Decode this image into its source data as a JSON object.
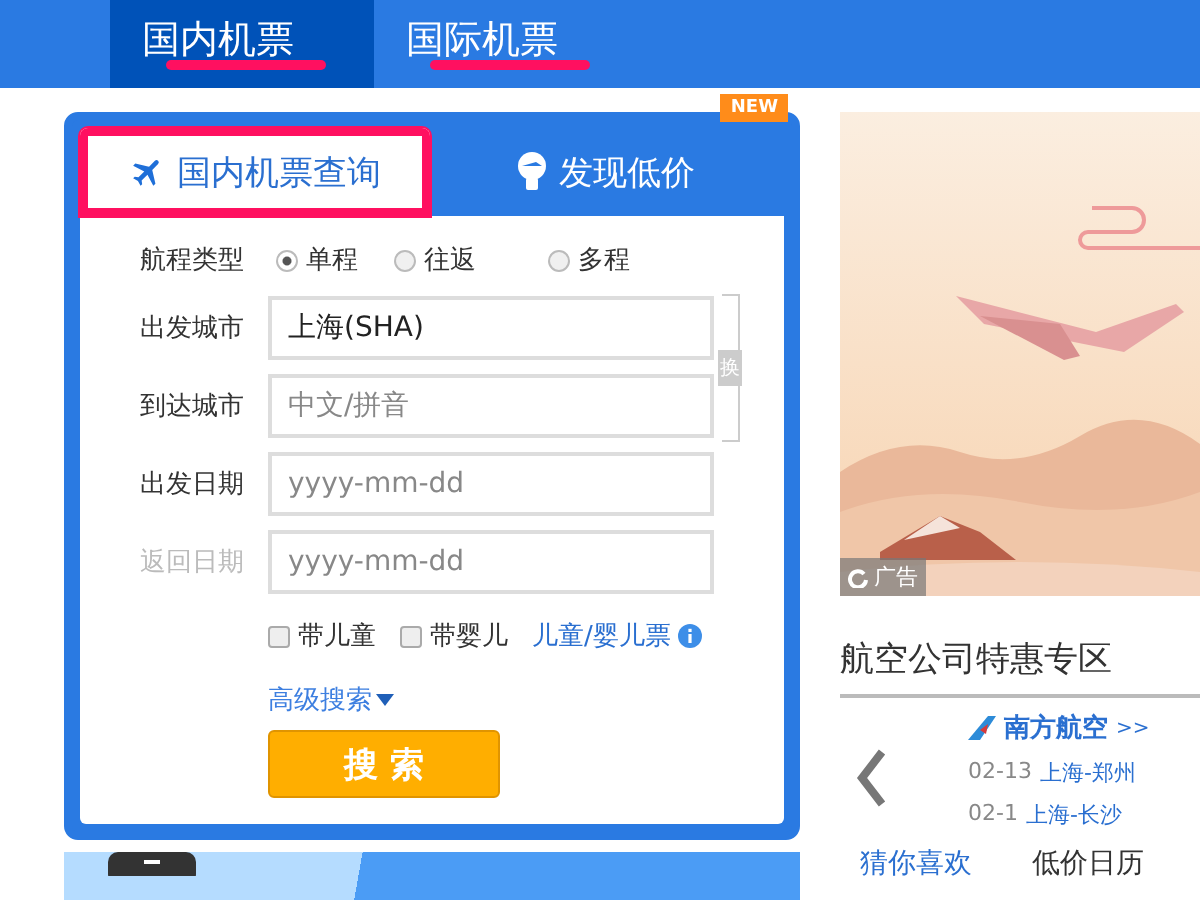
{
  "top_tabs": [
    {
      "label": "国内机票",
      "selected": true,
      "annotated": true
    },
    {
      "label": "国际机票",
      "selected": false,
      "annotated": true
    }
  ],
  "search_panel": {
    "tabs": [
      {
        "label": "国内机票查询",
        "selected": true,
        "kind": "plane",
        "annotated": true
      },
      {
        "label": "发现低价",
        "selected": false,
        "kind": "bulb",
        "annotated": false
      }
    ],
    "badge": "NEW",
    "trip_type": {
      "label": "航程类型",
      "options": [
        {
          "label": "单程",
          "selected": true
        },
        {
          "label": "往返",
          "selected": false
        },
        {
          "label": "多程",
          "selected": false
        }
      ]
    },
    "fields": [
      {
        "label": "出发城市",
        "value": "上海(SHA)",
        "disabled": false
      },
      {
        "label": "到达城市",
        "placeholder": "中文/拼音",
        "disabled": false
      },
      {
        "label": "出发日期",
        "placeholder": "yyyy-mm-dd",
        "disabled": false
      },
      {
        "label": "返回日期",
        "placeholder": "yyyy-mm-dd",
        "disabled": true
      }
    ],
    "swap": "换",
    "checkboxes": [
      {
        "label": "带儿童",
        "checked": false
      },
      {
        "label": "带婴儿",
        "checked": false
      }
    ],
    "info_link": "儿童/婴儿票",
    "advanced": "高级搜索",
    "submit": "搜 索"
  },
  "ad": {
    "badge": "广告"
  },
  "deals": {
    "title": "航空公司特惠专区",
    "airline": "南方航空",
    "more": ">>",
    "routes": [
      {
        "date": "02-13",
        "route": "上海-郑州"
      },
      {
        "date": "02-1",
        "route": "上海-长沙"
      }
    ]
  },
  "bottom_tabs": [
    "猜你喜欢",
    "低价日历"
  ]
}
